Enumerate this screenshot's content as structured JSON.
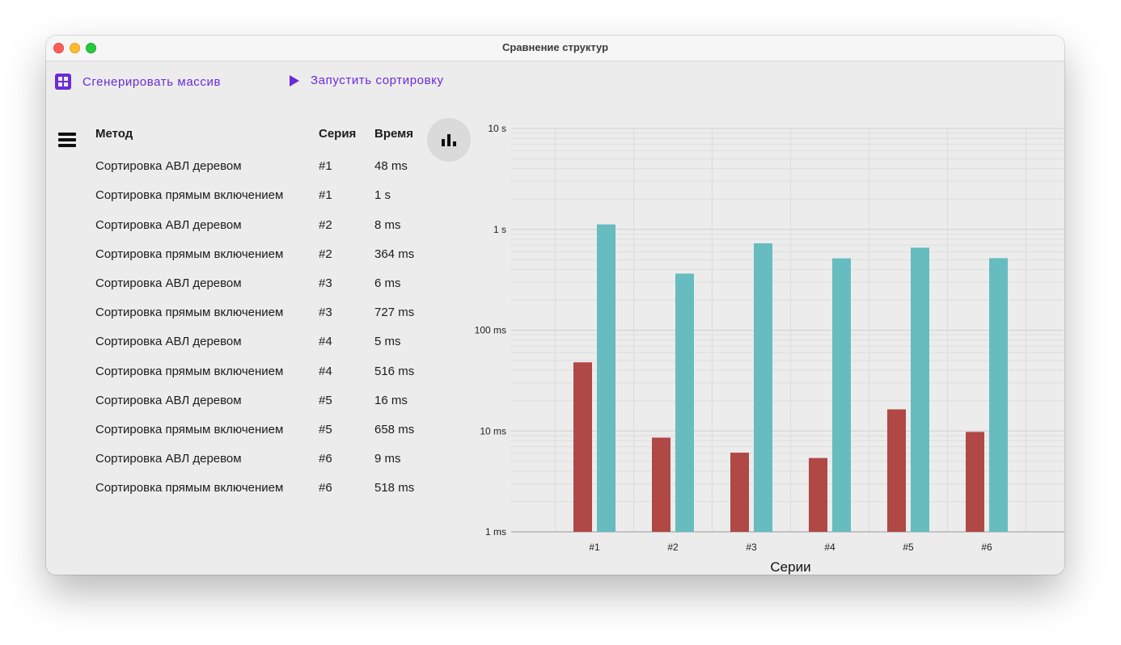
{
  "window": {
    "title": "Сравнение структур"
  },
  "toolbar": {
    "generate_label": "Сгенерировать массив",
    "generate_icon": "grid-icon",
    "run_label": "Запустить сортировку",
    "run_icon": "play-icon"
  },
  "colors": {
    "accent": "#6a2bd8",
    "avl": "#b04845",
    "insertion": "#66bcbf"
  },
  "table": {
    "headers": {
      "method": "Метод",
      "series": "Серия",
      "time": "Время"
    },
    "rows": [
      {
        "method": "Сортировка АВЛ деревом",
        "series": "#1",
        "time": "48 ms"
      },
      {
        "method": "Сортировка прямым включением",
        "series": "#1",
        "time": "1 s"
      },
      {
        "method": "Сортировка АВЛ деревом",
        "series": "#2",
        "time": "8 ms"
      },
      {
        "method": "Сортировка прямым включением",
        "series": "#2",
        "time": "364 ms"
      },
      {
        "method": "Сортировка АВЛ деревом",
        "series": "#3",
        "time": "6 ms"
      },
      {
        "method": "Сортировка прямым включением",
        "series": "#3",
        "time": "727 ms"
      },
      {
        "method": "Сортировка АВЛ деревом",
        "series": "#4",
        "time": "5 ms"
      },
      {
        "method": "Сортировка прямым включением",
        "series": "#4",
        "time": "516 ms"
      },
      {
        "method": "Сортировка АВЛ деревом",
        "series": "#5",
        "time": "16 ms"
      },
      {
        "method": "Сортировка прямым включением",
        "series": "#5",
        "time": "658 ms"
      },
      {
        "method": "Сортировка АВЛ деревом",
        "series": "#6",
        "time": "9 ms"
      },
      {
        "method": "Сортировка прямым включением",
        "series": "#6",
        "time": "518 ms"
      }
    ]
  },
  "chart_data": {
    "type": "bar",
    "categories": [
      "#1",
      "#2",
      "#3",
      "#4",
      "#5",
      "#6"
    ],
    "series": [
      {
        "values_ms": [
          48,
          8.6,
          6.1,
          5.4,
          16.4,
          9.8
        ],
        "color": "#b04845"
      },
      {
        "values_ms": [
          1120,
          364,
          727,
          516,
          658,
          518
        ],
        "color": "#66bcbf"
      }
    ],
    "xlabel": "Серии",
    "ylabel": "",
    "y_scale": "log",
    "ylim_ms": [
      1,
      10000
    ],
    "y_tick_labels": [
      "1 ms",
      "10 ms",
      "100 ms",
      "1 s",
      "10 s"
    ],
    "grid": true
  }
}
